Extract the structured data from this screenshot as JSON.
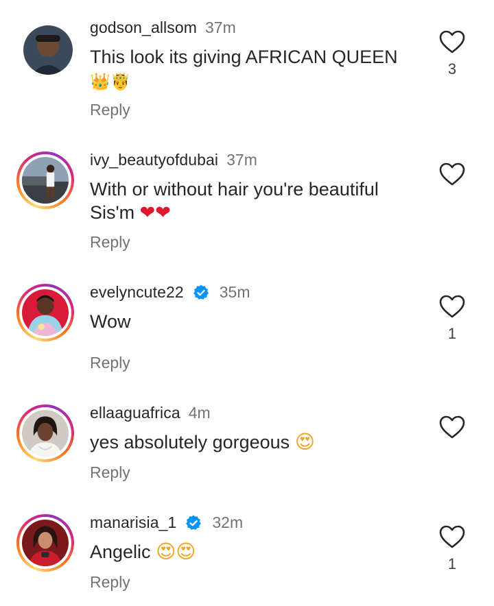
{
  "comments": [
    {
      "username": "godson_allsom",
      "time": "37m",
      "text": "This look its giving AFRICAN QUEEN",
      "emoji_line": "👑🤴",
      "reply": "Reply",
      "likes": "3",
      "verified": false,
      "story_ring": false
    },
    {
      "username": "ivy_beautyofdubai",
      "time": "37m",
      "text_line1": "With or without hair you're beautiful",
      "text_line2": "Sis'm",
      "emoji": "❤❤",
      "reply": "Reply",
      "likes": "",
      "verified": false,
      "story_ring": true
    },
    {
      "username": "evelyncute22",
      "time": "35m",
      "text": "Wow",
      "reply": "Reply",
      "likes": "1",
      "verified": true,
      "story_ring": true
    },
    {
      "username": "ellaaguafrica",
      "time": "4m",
      "text": "yes absolutely gorgeous",
      "emoji": "😍",
      "reply": "Reply",
      "likes": "",
      "verified": false,
      "story_ring": true
    },
    {
      "username": "manarisia_1",
      "time": "32m",
      "text": "Angelic",
      "emoji": "😍😍",
      "reply": "Reply",
      "likes": "1",
      "verified": true,
      "story_ring": true
    }
  ],
  "icons": {
    "like": "heart-outline-icon",
    "verified": "verified-badge-icon"
  },
  "colors": {
    "text": "#262626",
    "secondary": "#737373",
    "verified": "#0095f6",
    "heart": "#e0182d"
  }
}
